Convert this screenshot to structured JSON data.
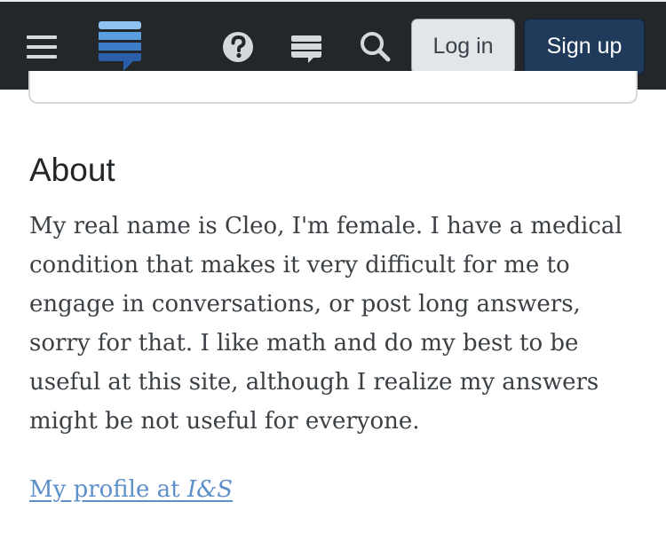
{
  "header": {
    "login_label": "Log in",
    "signup_label": "Sign up",
    "icons": [
      "menu-icon",
      "stack-exchange-logo",
      "help-icon",
      "chat-icon",
      "search-icon"
    ],
    "colors": {
      "bar_background": "#23272a",
      "login_background": "#e3e6e8",
      "signup_background": "#1f3a5b",
      "logo_blue": "#3d7cc9"
    }
  },
  "about": {
    "heading": "About",
    "paragraph_lines": [
      "My real name is Cleo, I'm female. I have a medical",
      "condition that makes it very difficult for me to",
      "engage in conversations, or post long answers,",
      "sorry for that. I like math and do my best to be",
      "useful at this site, although I realize my answers",
      "might be not useful for everyone."
    ],
    "link": {
      "prefix": "My profile at ",
      "site": "I&S"
    },
    "colors": {
      "link": "#5d8fc9"
    }
  }
}
